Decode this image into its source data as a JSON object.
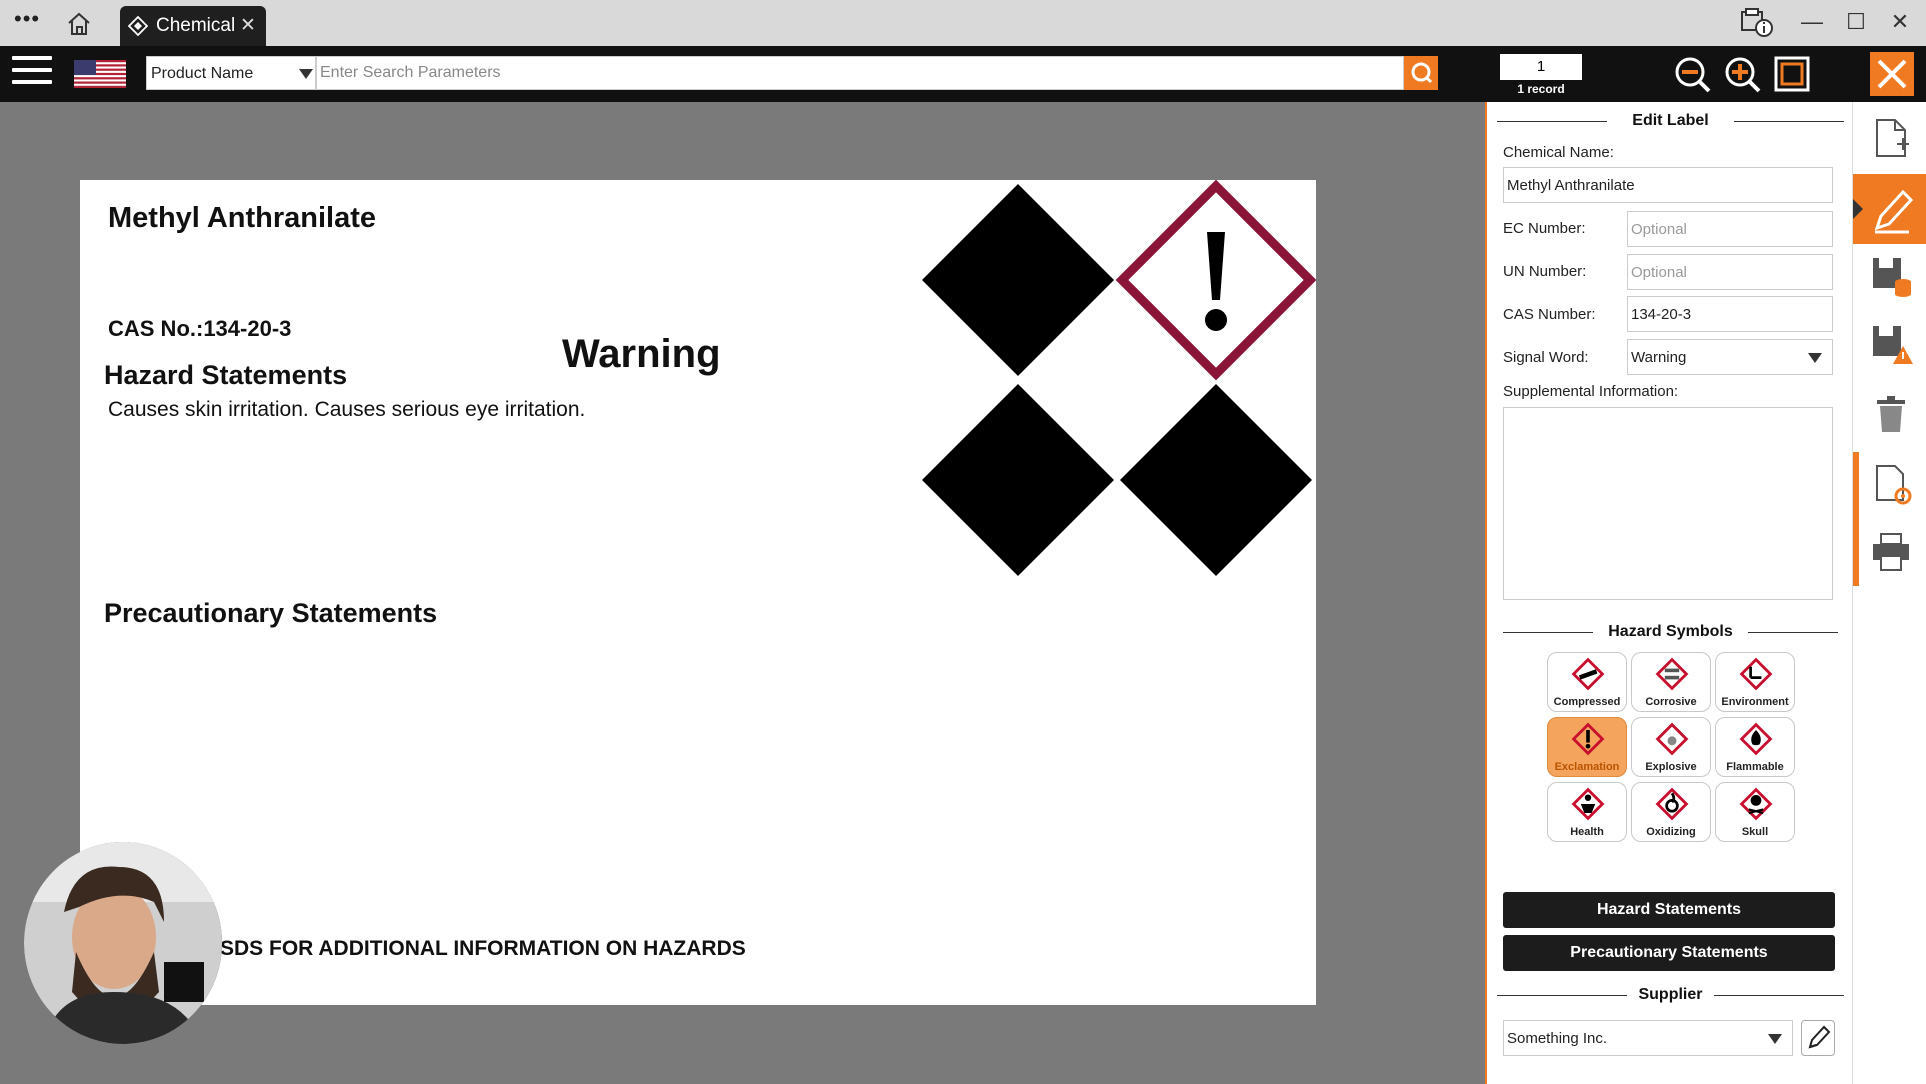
{
  "window": {
    "tab_label": "Chemical",
    "tab_close": "✕",
    "minimize": "—",
    "maximize": "☐",
    "close": "✕"
  },
  "toolbar": {
    "flag_icon": "us-flag-icon",
    "search_type": "Product Name",
    "search_placeholder": "Enter Search Parameters",
    "record_number": "1",
    "record_count": "1 record"
  },
  "label": {
    "chemical_name": "Methyl Anthranilate",
    "cas": "CAS No.:134-20-3",
    "signal_word": "Warning",
    "hazard_heading": "Hazard Statements",
    "hazard_text": "Causes skin irritation. Causes serious eye irritation.",
    "precaution_heading": "Precautionary Statements",
    "footer": "SDS FOR ADDITIONAL INFORMATION ON HAZARDS"
  },
  "panel": {
    "title": "Edit Label",
    "chemical_name_label": "Chemical Name:",
    "chemical_name_value": "Methyl Anthranilate",
    "ec_label": "EC Number:",
    "ec_placeholder": "Optional",
    "un_label": "UN Number:",
    "un_placeholder": "Optional",
    "cas_label": "CAS Number:",
    "cas_value": "134-20-3",
    "signal_label": "Signal Word:",
    "signal_value": "Warning",
    "supp_label": "Supplemental Information:",
    "hazard_symbols_title": "Hazard Symbols",
    "hazard_symbols": [
      {
        "label": "Compressed",
        "active": false
      },
      {
        "label": "Corrosive",
        "active": false
      },
      {
        "label": "Environment",
        "active": false
      },
      {
        "label": "Exclamation",
        "active": true
      },
      {
        "label": "Explosive",
        "active": false
      },
      {
        "label": "Flammable",
        "active": false
      },
      {
        "label": "Health",
        "active": false
      },
      {
        "label": "Oxidizing",
        "active": false
      },
      {
        "label": "Skull",
        "active": false
      }
    ],
    "hazard_statements_button": "Hazard Statements",
    "precautionary_statements_button": "Precautionary Statements",
    "supplier_title": "Supplier",
    "supplier_value": "Something Inc."
  },
  "colors": {
    "accent": "#f07a22",
    "ghs_red": "#8b1538",
    "dark": "#1c1c1c"
  }
}
